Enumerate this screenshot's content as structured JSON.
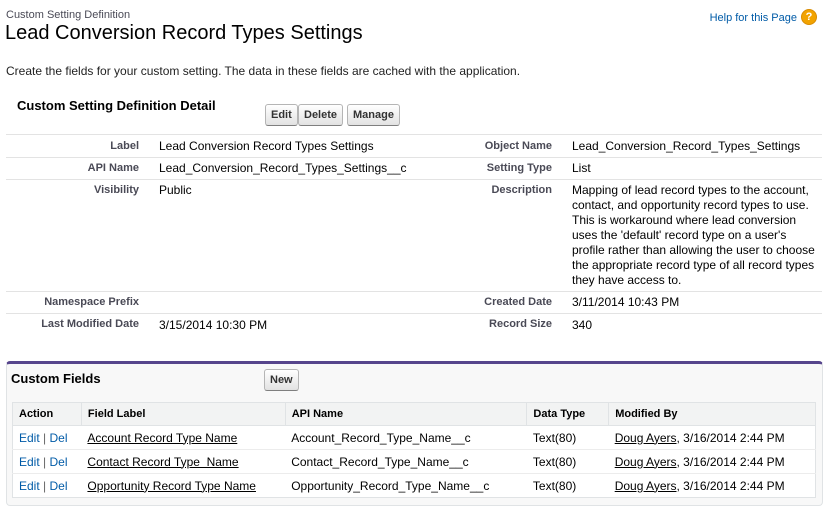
{
  "header": {
    "breadcrumb": "Custom Setting Definition",
    "title": "Lead Conversion Record Types Settings",
    "help_link": "Help for this Page",
    "help_icon_glyph": "?",
    "intro": "Create the fields for your custom setting. The data in these fields are cached with the application."
  },
  "detail": {
    "heading": "Custom Setting Definition Detail",
    "buttons": {
      "edit": "Edit",
      "delete": "Delete",
      "manage": "Manage"
    },
    "fields": {
      "label_label": "Label",
      "label_value": "Lead Conversion Record Types Settings",
      "api_name_label": "API Name",
      "api_name_value": "Lead_Conversion_Record_Types_Settings__c",
      "visibility_label": "Visibility",
      "visibility_value": "Public",
      "namespace_label": "Namespace Prefix",
      "namespace_value": "",
      "last_modified_label": "Last Modified Date",
      "last_modified_value": "3/15/2014 10:30 PM",
      "object_name_label": "Object Name",
      "object_name_value": "Lead_Conversion_Record_Types_Settings",
      "setting_type_label": "Setting Type",
      "setting_type_value": "List",
      "description_label": "Description",
      "description_value": "Mapping of lead record types to the account, contact, and opportunity record types to use. This is workaround where lead conversion uses the 'default' record type on a user's profile rather than allowing the user to choose the appropriate record type of all record types they have access to.",
      "created_label": "Created Date",
      "created_value": "3/11/2014 10:43 PM",
      "record_size_label": "Record Size",
      "record_size_value": "340"
    }
  },
  "custom_fields": {
    "title": "Custom Fields",
    "new_button": "New",
    "columns": {
      "action": "Action",
      "field_label": "Field Label",
      "api_name": "API Name",
      "data_type": "Data Type",
      "modified_by": "Modified By"
    },
    "action_edit": "Edit",
    "action_sep": "|",
    "action_del": "Del",
    "rows": [
      {
        "field_label": "Account Record Type Name",
        "api_name": "Account_Record_Type_Name__c",
        "data_type": "Text(80)",
        "modified_user": "Doug Ayers",
        "modified_date": ", 3/16/2014 2:44 PM"
      },
      {
        "field_label": "Contact Record Type  Name",
        "api_name": "Contact_Record_Type_Name__c",
        "data_type": "Text(80)",
        "modified_user": "Doug Ayers",
        "modified_date": ", 3/16/2014 2:44 PM"
      },
      {
        "field_label": "Opportunity Record Type Name",
        "api_name": "Opportunity_Record_Type_Name__c",
        "data_type": "Text(80)",
        "modified_user": "Doug Ayers",
        "modified_date": ", 3/16/2014 2:44 PM"
      }
    ]
  },
  "colors": {
    "link": "#015ba7",
    "panel_accent": "#56458c",
    "help_icon": "#f2a300"
  }
}
